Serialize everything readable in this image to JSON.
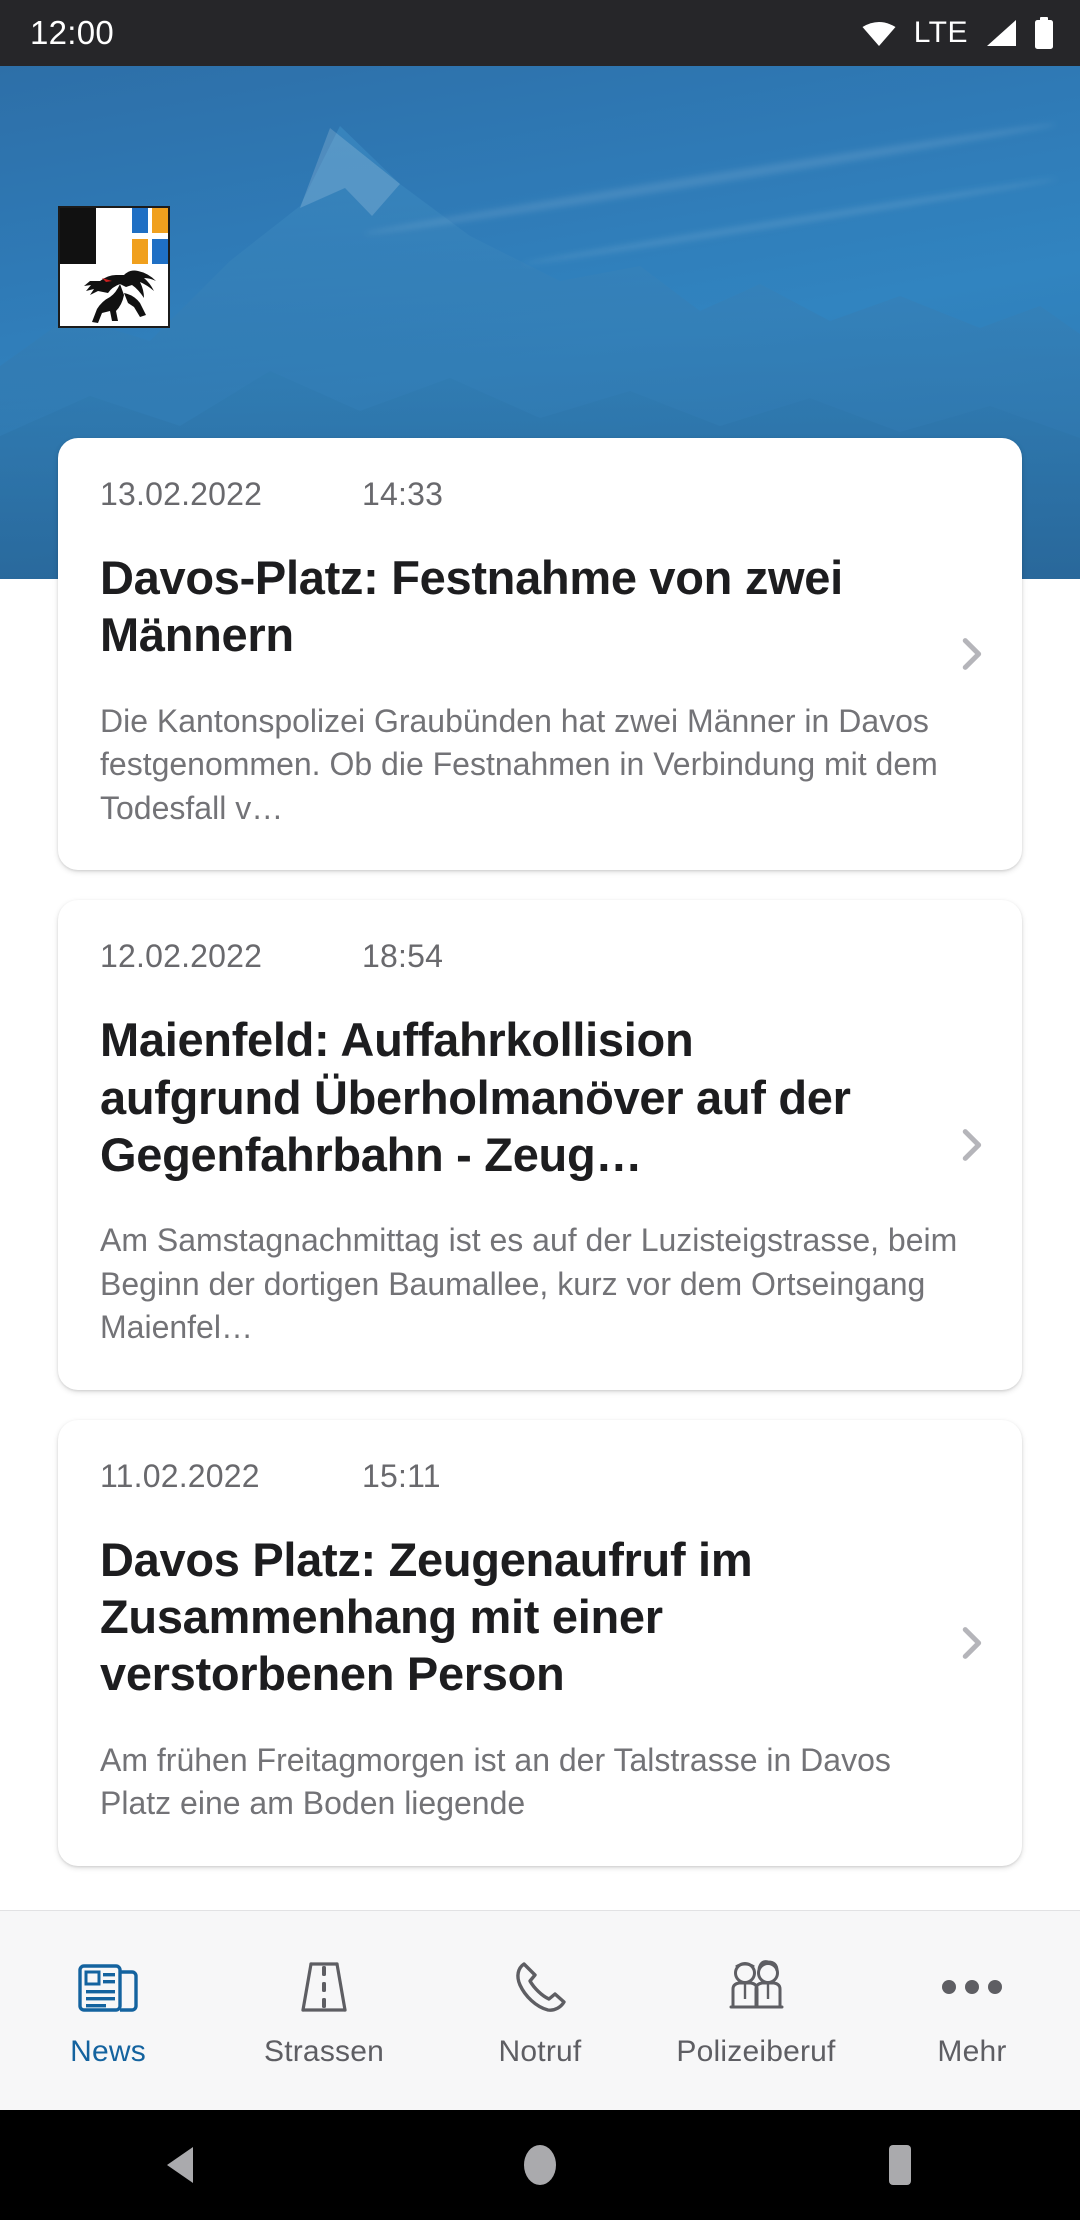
{
  "status_bar": {
    "clock": "12:00",
    "network_label": "LTE",
    "icons": [
      "wifi-icon",
      "signal-icon",
      "battery-icon"
    ]
  },
  "header": {
    "logo_alt": "Kanton Graubünden coat of arms",
    "background": "mountain-photo"
  },
  "colors": {
    "accent": "#14639f",
    "hero_blue": "#2f7ab6",
    "status_bar": "#262629",
    "tabbar_bg": "#f7f7f8",
    "meta_text": "#69696d",
    "body_text": "#737377",
    "title_text": "#1d1d1f",
    "chevron": "#b5b5ba"
  },
  "news": [
    {
      "date": "13.02.2022",
      "time": "14:33",
      "title": "Davos-Platz: Festnahme von zwei Männern",
      "body": "Die Kantonspolizei Graubünden hat zwei Männer in Davos festgenommen. Ob die Festnahmen in Verbindung mit dem Todesfall v…",
      "chevron": "chevron-right-icon"
    },
    {
      "date": "12.02.2022",
      "time": "18:54",
      "title": "Maienfeld: Auffahrkollision aufgrund Überholmanöver auf der Gegenfahrbahn - Zeug…",
      "body": "Am Samstagnachmittag ist es auf der Luzisteigstrasse, beim Beginn der dortigen Baumallee, kurz vor dem Ortseingang Maienfel…",
      "chevron": "chevron-right-icon"
    },
    {
      "date": "11.02.2022",
      "time": "15:11",
      "title": "Davos Platz: Zeugenaufruf im Zusammenhang mit einer verstorbenen Person",
      "body": "Am frühen Freitagmorgen ist an der Talstrasse in Davos Platz eine am Boden liegende",
      "chevron": "chevron-right-icon"
    }
  ],
  "tabbar": {
    "items": [
      {
        "label": "News",
        "icon": "newspaper-icon",
        "active": true
      },
      {
        "label": "Strassen",
        "icon": "road-icon",
        "active": false
      },
      {
        "label": "Notruf",
        "icon": "phone-icon",
        "active": false
      },
      {
        "label": "Polizeiberuf",
        "icon": "people-icon",
        "active": false
      },
      {
        "label": "Mehr",
        "icon": "ellipsis-icon",
        "active": false
      }
    ]
  },
  "android_nav": {
    "buttons": [
      {
        "name": "back-button",
        "icon": "triangle-back-icon"
      },
      {
        "name": "home-button",
        "icon": "circle-home-icon"
      },
      {
        "name": "recents-button",
        "icon": "square-recents-icon"
      }
    ]
  }
}
